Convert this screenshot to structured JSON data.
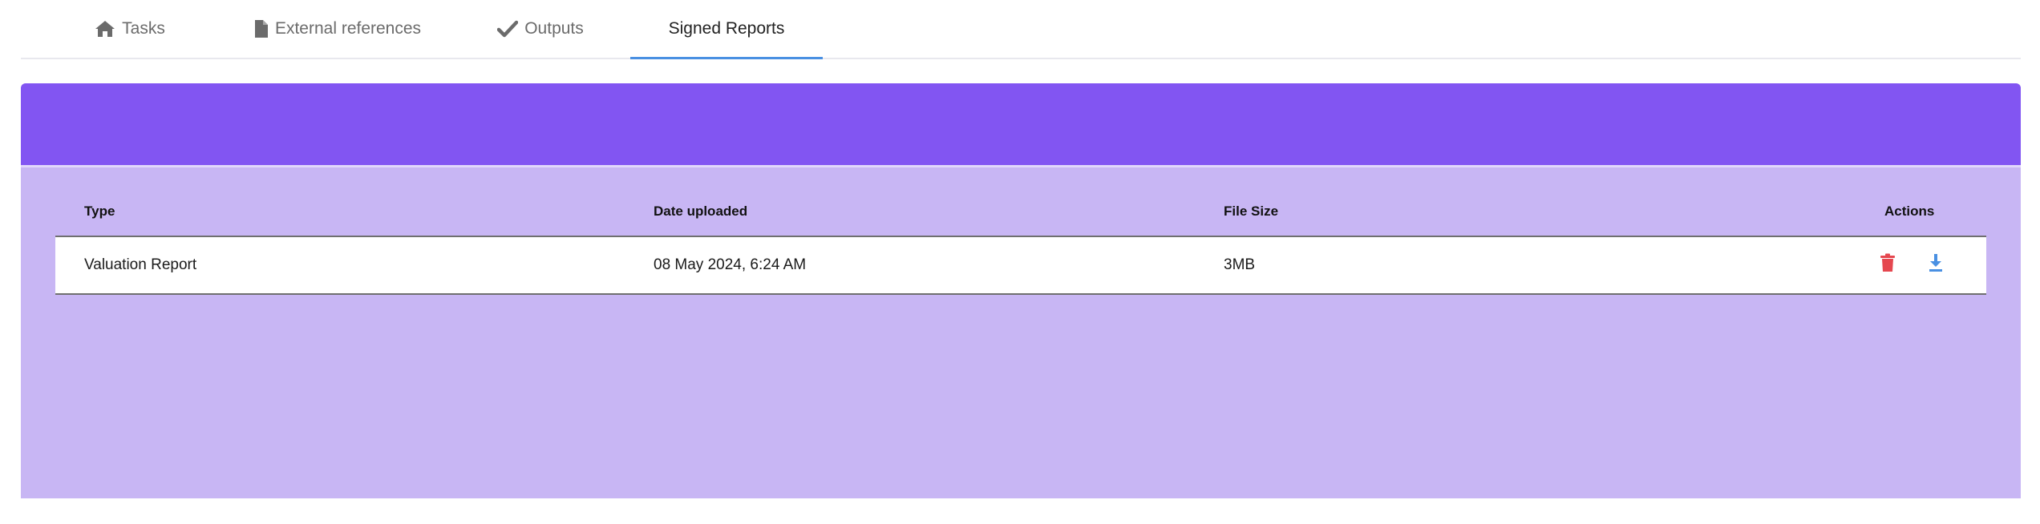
{
  "tabs": [
    {
      "label": "Tasks",
      "icon": "home-icon",
      "active": false
    },
    {
      "label": "External references",
      "icon": "file-icon",
      "active": false
    },
    {
      "label": "Outputs",
      "icon": "check-icon",
      "active": false
    },
    {
      "label": "Signed Reports",
      "icon": null,
      "active": true
    }
  ],
  "colors": {
    "accent": "#4a90e2",
    "panel_header": "#8255f2",
    "panel_body": "#c8b6f4",
    "delete": "#e5474f",
    "download": "#4a90e2"
  },
  "table": {
    "headers": {
      "type": "Type",
      "date": "Date uploaded",
      "size": "File Size",
      "actions": "Actions"
    },
    "rows": [
      {
        "type": "Valuation Report",
        "date": "08 May 2024, 6:24 AM",
        "size": "3MB",
        "actions": [
          "trash-icon",
          "download-icon"
        ]
      }
    ]
  }
}
